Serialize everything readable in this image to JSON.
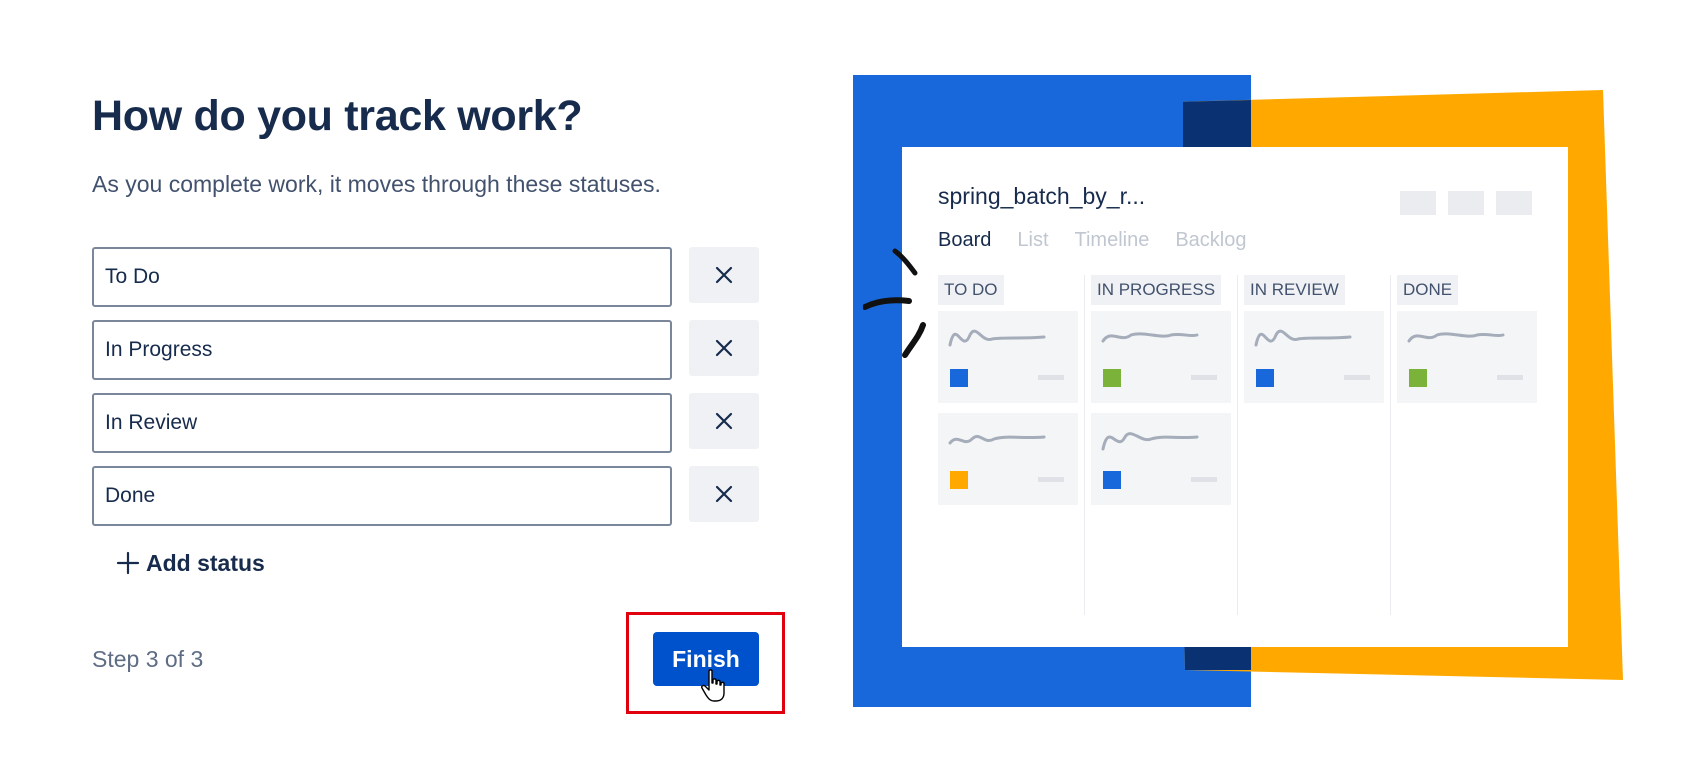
{
  "heading": "How do you track work?",
  "subtitle": "As you complete work, it moves through these statuses.",
  "statuses": [
    {
      "value": "To Do"
    },
    {
      "value": "In Progress"
    },
    {
      "value": "In Review"
    },
    {
      "value": "Done"
    }
  ],
  "add_status_label": "Add status",
  "step_text": "Step 3 of 3",
  "finish_label": "Finish",
  "illustration": {
    "board_title": "spring_batch_by_r...",
    "tabs": [
      "Board",
      "List",
      "Timeline",
      "Backlog"
    ],
    "columns": [
      "TO DO",
      "IN PROGRESS",
      "IN REVIEW",
      "DONE"
    ]
  },
  "colors": {
    "primary_blue": "#0052cc",
    "illustration_blue": "#1868db",
    "illustration_orange": "#ffa900",
    "highlight_red": "#e0000e",
    "card_green": "#7ab23a",
    "card_blue": "#1868db",
    "card_orange": "#ffa900"
  }
}
